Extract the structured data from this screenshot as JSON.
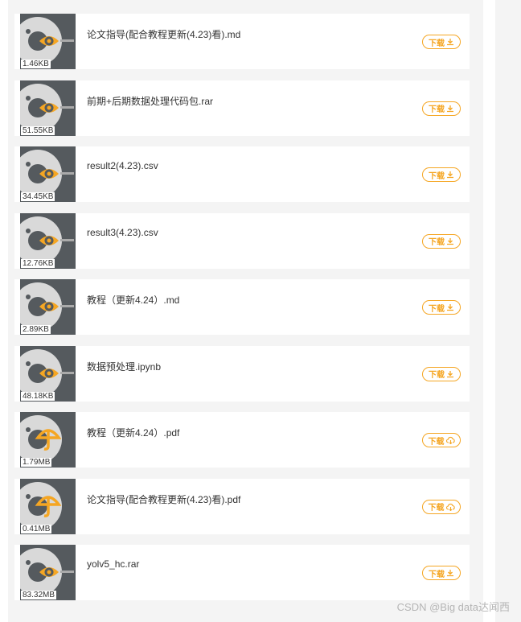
{
  "colors": {
    "accent": "#f5a623",
    "thumb_bg": "#555a5e",
    "panel_bg": "#f4f4f4"
  },
  "files": [
    {
      "name": "论文指导(配合教程更新(4.23)看).md",
      "size": "1.46KB",
      "thumb_icon": "eye-icon",
      "button": "下载",
      "button_icon": "download-icon"
    },
    {
      "name": "前期+后期数据处理代码包.rar",
      "size": "51.55KB",
      "thumb_icon": "eye-icon",
      "button": "下载",
      "button_icon": "download-icon"
    },
    {
      "name": "result2(4.23).csv",
      "size": "34.45KB",
      "thumb_icon": "eye-icon",
      "button": "下载",
      "button_icon": "download-icon"
    },
    {
      "name": "result3(4.23).csv",
      "size": "12.76KB",
      "thumb_icon": "eye-icon",
      "button": "下载",
      "button_icon": "download-icon"
    },
    {
      "name": "教程（更新4.24）.md",
      "size": "2.89KB",
      "thumb_icon": "eye-icon",
      "button": "下载",
      "button_icon": "download-icon"
    },
    {
      "name": "数据预处理.ipynb",
      "size": "48.18KB",
      "thumb_icon": "eye-icon",
      "button": "下载",
      "button_icon": "download-icon"
    },
    {
      "name": "教程（更新4.24）.pdf",
      "size": "1.79MB",
      "thumb_icon": "umbrella-icon",
      "button": "下载",
      "button_icon": "cloud-download-icon"
    },
    {
      "name": "论文指导(配合教程更新(4.23)看).pdf",
      "size": "0.41MB",
      "thumb_icon": "umbrella-icon",
      "button": "下载",
      "button_icon": "cloud-download-icon"
    },
    {
      "name": "yolv5_hc.rar",
      "size": "83.32MB",
      "thumb_icon": "eye-icon",
      "button": "下载",
      "button_icon": "download-icon"
    }
  ],
  "watermark": "CSDN @Big data达闻西"
}
